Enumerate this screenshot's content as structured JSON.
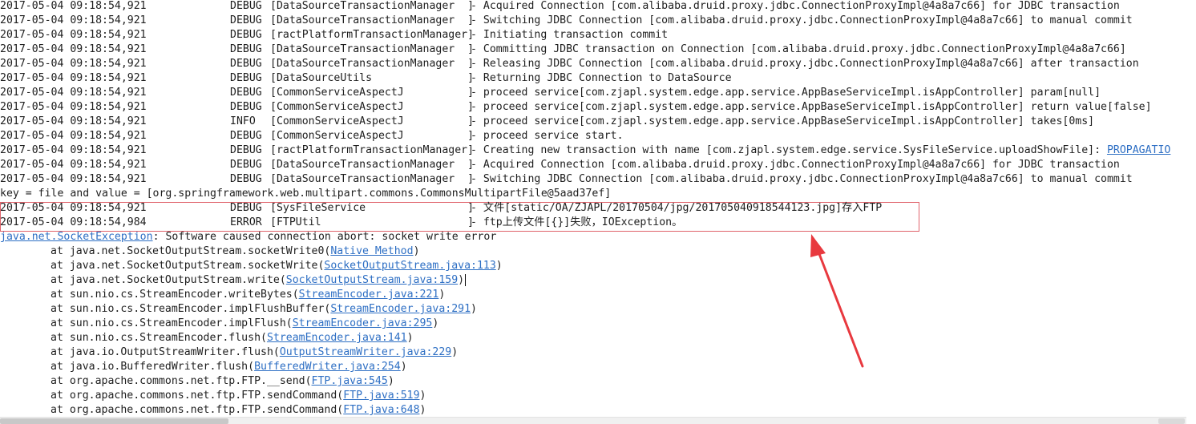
{
  "log_lines": [
    {
      "ts": "2017-05-04 09:18:54,921",
      "level": "DEBUG",
      "category": "[DataSourceTransactionManager  ]",
      "message": "- Acquired Connection [com.alibaba.druid.proxy.jdbc.ConnectionProxyImpl@4a8a7c66] for JDBC transaction"
    },
    {
      "ts": "2017-05-04 09:18:54,921",
      "level": "DEBUG",
      "category": "[DataSourceTransactionManager  ]",
      "message": "- Switching JDBC Connection [com.alibaba.druid.proxy.jdbc.ConnectionProxyImpl@4a8a7c66] to manual commit"
    },
    {
      "ts": "2017-05-04 09:18:54,921",
      "level": "DEBUG",
      "category": "[ractPlatformTransactionManager]",
      "message": "- Initiating transaction commit"
    },
    {
      "ts": "2017-05-04 09:18:54,921",
      "level": "DEBUG",
      "category": "[DataSourceTransactionManager  ]",
      "message": "- Committing JDBC transaction on Connection [com.alibaba.druid.proxy.jdbc.ConnectionProxyImpl@4a8a7c66]"
    },
    {
      "ts": "2017-05-04 09:18:54,921",
      "level": "DEBUG",
      "category": "[DataSourceTransactionManager  ]",
      "message": "- Releasing JDBC Connection [com.alibaba.druid.proxy.jdbc.ConnectionProxyImpl@4a8a7c66] after transaction"
    },
    {
      "ts": "2017-05-04 09:18:54,921",
      "level": "DEBUG",
      "category": "[DataSourceUtils               ]",
      "message": "- Returning JDBC Connection to DataSource"
    },
    {
      "ts": "2017-05-04 09:18:54,921",
      "level": "DEBUG",
      "category": "[CommonServiceAspectJ          ]",
      "message": "- proceed service[com.zjapl.system.edge.app.service.AppBaseServiceImpl.isAppController] param[null]"
    },
    {
      "ts": "2017-05-04 09:18:54,921",
      "level": "DEBUG",
      "category": "[CommonServiceAspectJ          ]",
      "message": "- proceed service[com.zjapl.system.edge.app.service.AppBaseServiceImpl.isAppController] return value[false]"
    },
    {
      "ts": "2017-05-04 09:18:54,921",
      "level": "INFO",
      "category": "[CommonServiceAspectJ          ]",
      "message": "- proceed service[com.zjapl.system.edge.app.service.AppBaseServiceImpl.isAppController] takes[0ms]"
    },
    {
      "ts": "2017-05-04 09:18:54,921",
      "level": "DEBUG",
      "category": "[CommonServiceAspectJ          ]",
      "message": "- proceed service start."
    },
    {
      "ts": "2017-05-04 09:18:54,921",
      "level": "DEBUG",
      "category": "[ractPlatformTransactionManager]",
      "message": "- Creating new transaction with name [com.zjapl.system.edge.service.SysFileService.uploadShowFile]: ",
      "link": "PROPAGATIO"
    },
    {
      "ts": "2017-05-04 09:18:54,921",
      "level": "DEBUG",
      "category": "[DataSourceTransactionManager  ]",
      "message": "- Acquired Connection [com.alibaba.druid.proxy.jdbc.ConnectionProxyImpl@4a8a7c66] for JDBC transaction"
    },
    {
      "ts": "2017-05-04 09:18:54,921",
      "level": "DEBUG",
      "category": "[DataSourceTransactionManager  ]",
      "message": "- Switching JDBC Connection [com.alibaba.druid.proxy.jdbc.ConnectionProxyImpl@4a8a7c66] to manual commit"
    }
  ],
  "plain_line": "key = file and value = [org.springframework.web.multipart.commons.CommonsMultipartFile@5aad37ef]",
  "highlighted_lines": [
    {
      "ts": "2017-05-04 09:18:54,921",
      "level": "DEBUG",
      "category": "[SysFileService                ]",
      "message": "- 文件[static/OA/ZJAPL/20170504/jpg/201705040918544123.jpg]存入FTP"
    },
    {
      "ts": "2017-05-04 09:18:54,984",
      "level": "ERROR",
      "category": "[FTPUtil                       ]",
      "message": "- ftp上传文件[{}]失败，IOException。"
    }
  ],
  "exception": {
    "link": "java.net.SocketException",
    "text": ": Software caused connection abort: socket write error"
  },
  "stack_frames": [
    {
      "method": "at java.net.SocketOutputStream.socketWrite0(",
      "source": "Native Method",
      "tail": ")"
    },
    {
      "method": "at java.net.SocketOutputStream.socketWrite(",
      "source": "SocketOutputStream.java:113",
      "tail": ")"
    },
    {
      "method": "at java.net.SocketOutputStream.write(",
      "source": "SocketOutputStream.java:159",
      "tail": ")"
    },
    {
      "method": "at sun.nio.cs.StreamEncoder.writeBytes(",
      "source": "StreamEncoder.java:221",
      "tail": ")"
    },
    {
      "method": "at sun.nio.cs.StreamEncoder.implFlushBuffer(",
      "source": "StreamEncoder.java:291",
      "tail": ")"
    },
    {
      "method": "at sun.nio.cs.StreamEncoder.implFlush(",
      "source": "StreamEncoder.java:295",
      "tail": ")"
    },
    {
      "method": "at sun.nio.cs.StreamEncoder.flush(",
      "source": "StreamEncoder.java:141",
      "tail": ")"
    },
    {
      "method": "at java.io.OutputStreamWriter.flush(",
      "source": "OutputStreamWriter.java:229",
      "tail": ")"
    },
    {
      "method": "at java.io.BufferedWriter.flush(",
      "source": "BufferedWriter.java:254",
      "tail": ")"
    },
    {
      "method": "at org.apache.commons.net.ftp.FTP.__send(",
      "source": "FTP.java:545",
      "tail": ")"
    },
    {
      "method": "at org.apache.commons.net.ftp.FTP.sendCommand(",
      "source": "FTP.java:519",
      "tail": ")"
    },
    {
      "method": "at org.apache.commons.net.ftp.FTP.sendCommand(",
      "source": "FTP.java:648",
      "tail": ")"
    }
  ],
  "colors": {
    "link": "#2e6fc4",
    "highlight_border": "#e0646c",
    "arrow": "#e8393f",
    "text": "#1e1e1e"
  },
  "icons": {
    "annotation": "red-arrow-icon"
  }
}
